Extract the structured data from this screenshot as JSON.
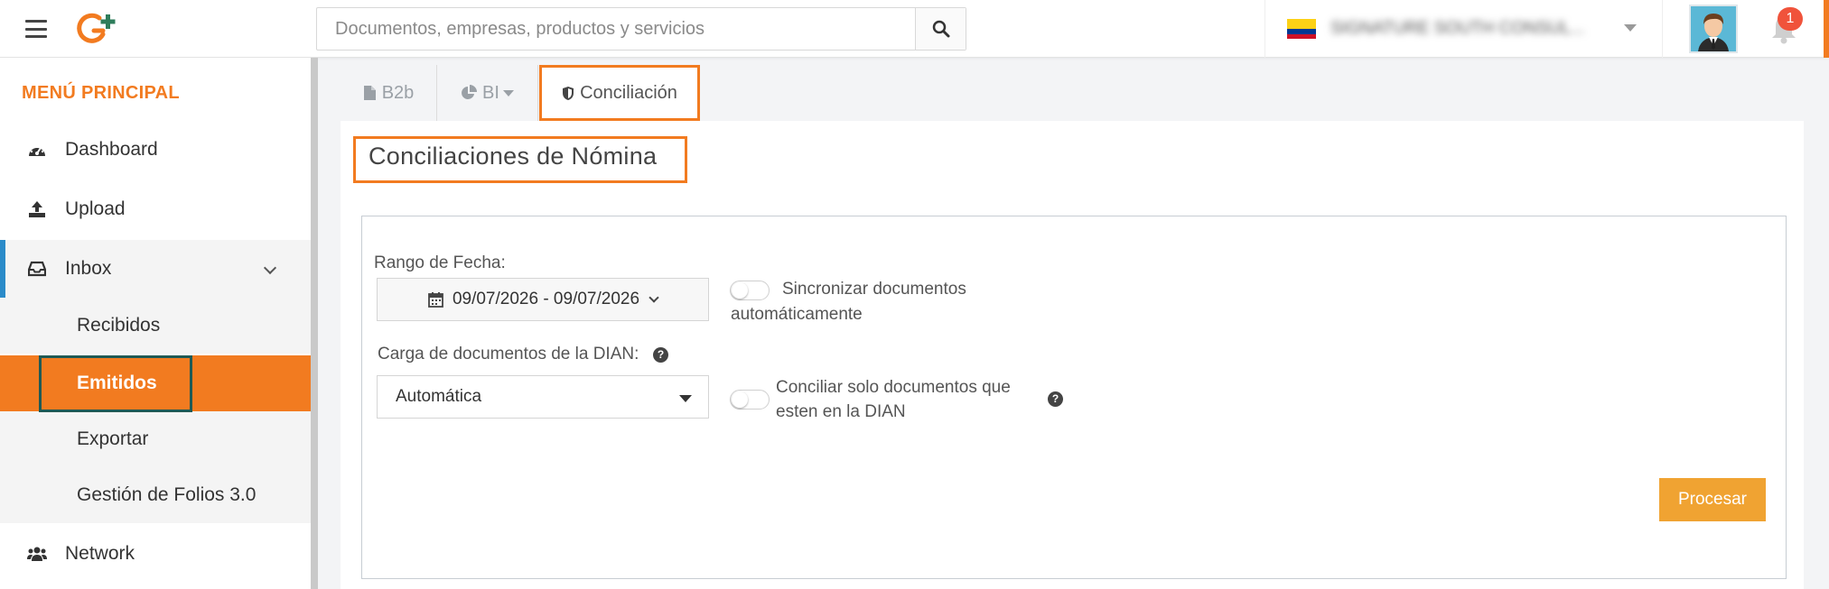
{
  "header": {
    "search_placeholder": "Documentos, empresas, productos y servicios",
    "company_name": "SIGNATURE SOUTH CONSUL...",
    "notification_count": "1",
    "icons": [
      "menu-icon",
      "logo",
      "search-icon",
      "colombia-flag-icon",
      "avatar",
      "bell-icon"
    ]
  },
  "sidebar": {
    "title": "MENÚ PRINCIPAL",
    "items": [
      {
        "label": "Dashboard",
        "icon": "dashboard-icon"
      },
      {
        "label": "Upload",
        "icon": "upload-icon"
      },
      {
        "label": "Inbox",
        "icon": "inbox-icon",
        "expanded": true
      },
      {
        "label": "Network",
        "icon": "users-icon"
      }
    ],
    "inbox_subitems": [
      {
        "label": "Recibidos"
      },
      {
        "label": "Emitidos",
        "active": true
      },
      {
        "label": "Exportar"
      },
      {
        "label": "Gestión de Folios 3.0"
      }
    ]
  },
  "tabs": [
    {
      "label": "B2b",
      "icon": "file-icon"
    },
    {
      "label": "BI",
      "icon": "pie-chart-icon",
      "dropdown": true
    },
    {
      "label": "Conciliación",
      "icon": "shield-icon",
      "active": true
    }
  ],
  "main": {
    "title": "Conciliaciones de Nómina",
    "date_range_label": "Rango de Fecha:",
    "date_range_value": "09/07/2026 - 09/07/2026",
    "sync_toggle_line1": "Sincronizar documentos",
    "sync_toggle_line2": "automáticamente",
    "dian_label": "Carga de documentos de la DIAN:",
    "dian_select_value": "Automática",
    "conciliar_line1": "Conciliar solo documentos que",
    "conciliar_line2": "esten en la DIAN",
    "help_glyph": "?",
    "process_button": "Procesar"
  },
  "colors": {
    "accent_orange": "#f27b20",
    "button_orange": "#f0a332",
    "inbox_marker": "#2a8bc9",
    "highlight_green": "#1f5a55",
    "badge_red": "#f0533b"
  }
}
